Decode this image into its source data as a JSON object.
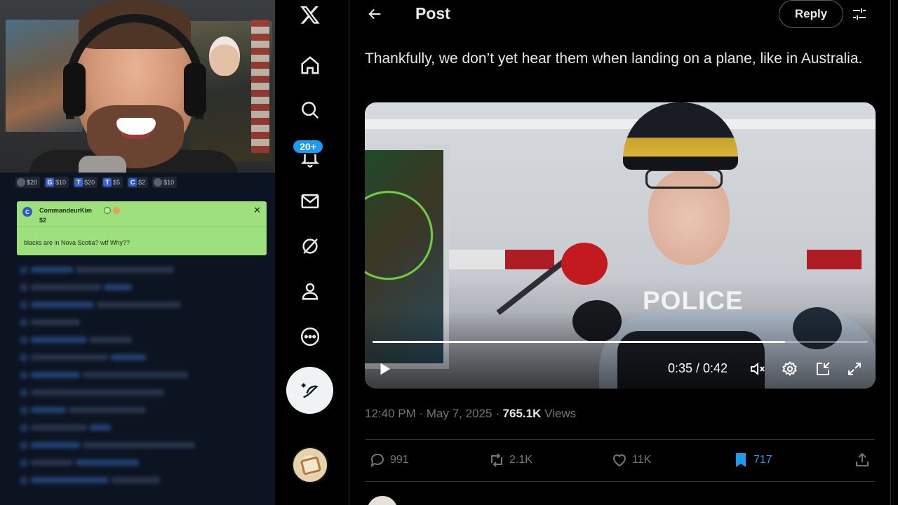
{
  "overlay": {
    "tips": [
      {
        "badge": "",
        "amount": "$20",
        "color": "#5a5f6b"
      },
      {
        "badge": "G",
        "amount": "$10",
        "color": "#3b63d8"
      },
      {
        "badge": "T",
        "amount": "$20",
        "color": "#3b63d8"
      },
      {
        "badge": "T",
        "amount": "$5",
        "color": "#3b63d8"
      },
      {
        "badge": "C",
        "amount": "$2",
        "color": "#2b59c9"
      },
      {
        "badge": "",
        "amount": "$10",
        "color": "#5a5f6b"
      }
    ],
    "pinned": {
      "avatar_letter": "C",
      "username": "CommandeurKim",
      "amount": "$2",
      "message": "blacks are in Nova Scotia? wtf Why??",
      "close_icon": "close-icon"
    }
  },
  "nav": {
    "logo": "x-logo-icon",
    "items": [
      "home-icon",
      "search-icon",
      "notifications-icon",
      "messages-icon",
      "grok-icon",
      "profile-icon",
      "more-icon"
    ],
    "notifications_badge": "20+",
    "compose_icon": "compose-post-icon",
    "accent_color": "#1d9bf0"
  },
  "header": {
    "title": "Post",
    "reply_label": "Reply"
  },
  "post": {
    "text": "Thankfully, we don’t yet hear them when landing on a plane, like in Australia.",
    "video": {
      "overlay_text": "POLICE",
      "current_time": "0:35",
      "duration": "0:42",
      "time_display": "0:35 / 0:42",
      "progress_fraction": 0.833
    },
    "timestamp": "12:40 PM · May 7, 2025 · ",
    "views_count": "765.1K",
    "views_label": " Views"
  },
  "actions": {
    "replies": "991",
    "reposts": "2.1K",
    "likes": "11K",
    "bookmarks": "717"
  }
}
